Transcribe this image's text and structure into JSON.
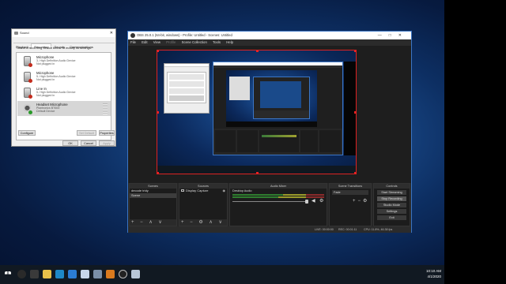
{
  "sound_dialog": {
    "title": "Sound",
    "tabs": [
      "Playback",
      "Recording",
      "Sounds",
      "Communications"
    ],
    "instruction": "Select a recording device below to modify its settings:",
    "devices": [
      {
        "name": "Microphone",
        "line1": "3- High Definition Audio Device",
        "line2": "Not plugged in",
        "badge": "red"
      },
      {
        "name": "Microphone",
        "line1": "5- High Definition Audio Device",
        "line2": "Not plugged in",
        "badge": "red"
      },
      {
        "name": "Line In",
        "line1": "5- High Definition Audio Device",
        "line2": "Not plugged in",
        "badge": "red"
      },
      {
        "name": "Headset Microphone",
        "line1": "Plantronics BT600",
        "line2": "Default Device",
        "badge": "green"
      }
    ],
    "configure_label": "Configure",
    "set_default_label": "Set Default",
    "properties_label": "Properties",
    "ok_label": "OK",
    "cancel_label": "Cancel",
    "apply_label": "Apply",
    "close_glyph": "✕"
  },
  "obs": {
    "title": "OBS 25.0.1 (64-bit, windows) - Profile: Untitled - Scenes: Untitled",
    "window_controls": "—□✕",
    "menu": [
      "File",
      "Edit",
      "View",
      "Profile",
      "Scene Collection",
      "Tools",
      "Help"
    ],
    "docks": {
      "scenes": {
        "header": "Scenes",
        "items": [
          "decode tridy",
          "Scene"
        ],
        "selected": 1
      },
      "sources": {
        "header": "Sources",
        "items": [
          "Display Capture"
        ]
      },
      "mixer": {
        "header": "Audio Mixer",
        "channel": "Desktop Audio"
      },
      "transitions": {
        "header": "Scene Transitions",
        "value": "Fade"
      },
      "controls": {
        "header": "Controls",
        "buttons": [
          "Start Streaming",
          "Stop Recording",
          "Studio Mode",
          "Settings",
          "Exit"
        ]
      }
    },
    "toolbar_glyphs": "+ − ∧ ∨",
    "sources_toolbar_glyphs": "+ − ⚙ ∧ ∨",
    "status": {
      "live": "LIVE: 00:00:00",
      "rec": "REC: 00:01:11",
      "cpu": "CPU: 11.8%, 46.38 fps"
    }
  },
  "clock": {
    "time": "10:10 AM",
    "date": "4/1/2020"
  },
  "colors": {
    "accent": "#3b75c4",
    "record_border": "#dd2222"
  }
}
